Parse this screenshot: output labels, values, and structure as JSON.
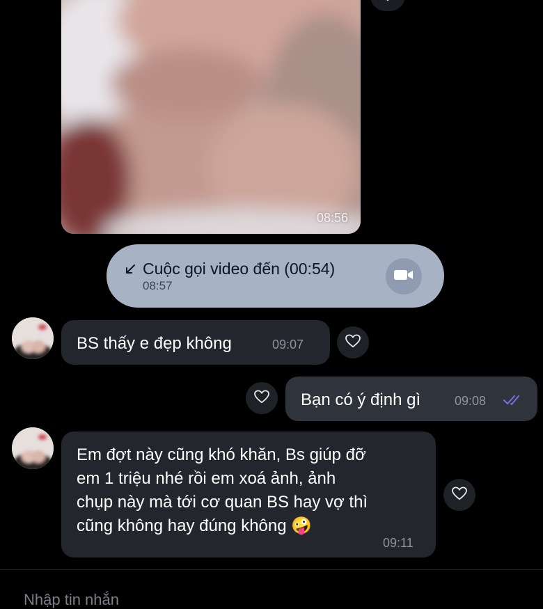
{
  "media_message": {
    "time": "08:56"
  },
  "call_message": {
    "label": "Cuộc gọi video đến (00:54)",
    "time": "08:57",
    "arrow_icon": "arrow-down-left-icon",
    "video_icon": "video-camera-icon"
  },
  "messages": [
    {
      "direction": "incoming",
      "text": "BS thấy e đẹp không",
      "time": "09:07"
    },
    {
      "direction": "outgoing",
      "text": "Bạn có ý định gì",
      "time": "09:08",
      "status_icon": "double-check-icon"
    },
    {
      "direction": "incoming",
      "lines": [
        "Em đợt này cũng khó khăn, Bs giúp đỡ",
        "em 1 triệu nhé rồi em xoá ảnh, ảnh",
        "chụp này mà tới cơ quan BS hay vợ thì",
        "cũng không hay đúng không"
      ],
      "emoji": "🤪",
      "time": "09:11"
    }
  ],
  "input": {
    "placeholder": "Nhập tin nhắn"
  },
  "colors": {
    "background": "#000000",
    "incoming_bubble": "#23262d",
    "outgoing_bubble": "#2f333b",
    "call_bubble": "#a7b2c4",
    "read_check": "#7a6fe0"
  }
}
